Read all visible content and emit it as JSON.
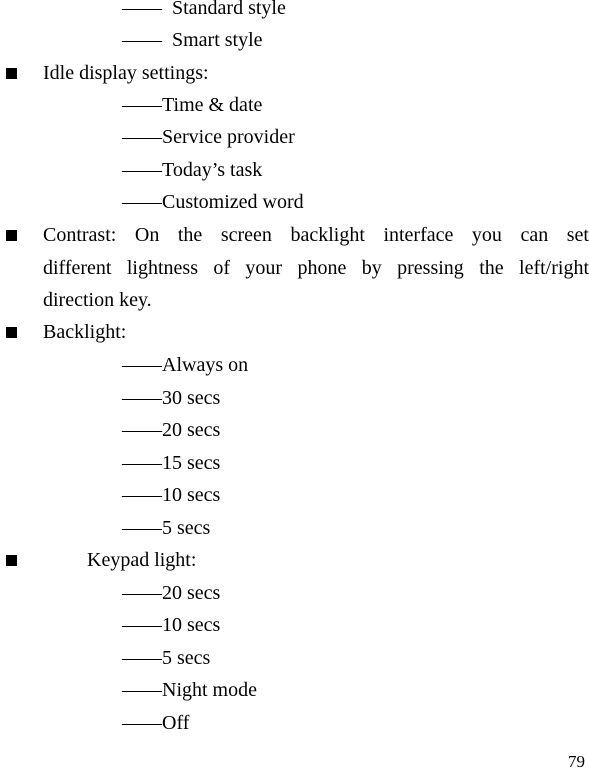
{
  "page": {
    "dash_glyph": "——",
    "style_items": [
      "Standard style",
      "Smart style"
    ],
    "idle_display": {
      "heading": "Idle display settings:",
      "items": [
        "Time & date",
        "Service provider",
        "Today’s task",
        "Customized word"
      ]
    },
    "contrast": {
      "lines": [
        "Contrast: On the screen backlight interface you can set",
        "different lightness of your phone by pressing the left/right",
        "direction key."
      ]
    },
    "backlight": {
      "heading": "Backlight:",
      "items": [
        "Always on",
        "30 secs",
        "20 secs",
        "15 secs",
        "10 secs",
        "5 secs"
      ]
    },
    "keypad_light": {
      "heading": "Keypad light:",
      "items": [
        "20 secs",
        "10 secs",
        "5 secs",
        "Night mode",
        "Off"
      ]
    },
    "page_number": "79"
  }
}
